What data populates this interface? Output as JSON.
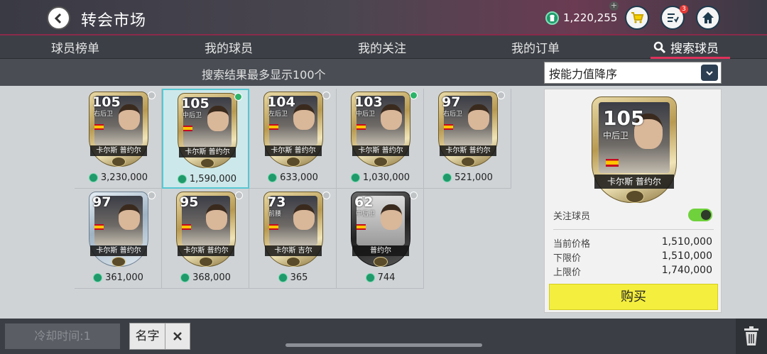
{
  "header": {
    "title": "转会市场",
    "coins": "1,220,255",
    "notification_count": "3",
    "icons": [
      "back-icon",
      "coin-icon",
      "cart-icon",
      "tasks-icon",
      "home-icon"
    ]
  },
  "tabs": [
    {
      "label": "球员榜单"
    },
    {
      "label": "我的球员"
    },
    {
      "label": "我的关注"
    },
    {
      "label": "我的订单"
    },
    {
      "label": "搜索球员",
      "active": true
    }
  ],
  "subbar": {
    "info": "搜索结果最多显示100个",
    "sort_selected": "按能力值降序"
  },
  "results": [
    {
      "rating": "105",
      "position": "右后卫",
      "name": "卡尔斯 普约尔",
      "price": "3,230,000",
      "style": "gold"
    },
    {
      "rating": "105",
      "position": "中后卫",
      "name": "卡尔斯 普约尔",
      "price": "1,590,000",
      "style": "gold",
      "selected": true,
      "favorite": true
    },
    {
      "rating": "104",
      "position": "左后卫",
      "name": "卡尔斯 普约尔",
      "price": "633,000",
      "style": "gold"
    },
    {
      "rating": "103",
      "position": "中后卫",
      "name": "卡尔斯 普约尔",
      "price": "1,030,000",
      "style": "gold",
      "favorite": true
    },
    {
      "rating": "97",
      "position": "右后卫",
      "name": "卡尔斯 普约尔",
      "price": "521,000",
      "style": "gold"
    },
    {
      "rating": "97",
      "position": "",
      "name": "卡尔斯 普约尔",
      "price": "361,000",
      "style": "silver"
    },
    {
      "rating": "95",
      "position": "",
      "name": "卡尔斯 普约尔",
      "price": "368,000",
      "style": "gold"
    },
    {
      "rating": "73",
      "position": "前腰",
      "name": "卡尔斯 吉尔",
      "price": "365",
      "style": "gold"
    },
    {
      "rating": "62",
      "position": "中后卫",
      "name": "普约尔",
      "price": "744",
      "style": "black"
    }
  ],
  "detail": {
    "rating": "105",
    "position": "中后卫",
    "name": "卡尔斯 普约尔",
    "follow_label": "关注球员",
    "follow_on": true,
    "current_price_label": "当前价格",
    "current_price": "1,510,000",
    "min_price_label": "下限价",
    "min_price": "1,510,000",
    "max_price_label": "上限价",
    "max_price": "1,740,000",
    "buy_label": "购买"
  },
  "bottom": {
    "cooldown": "冷却时间:1",
    "filter_chip": "名字"
  },
  "colors": {
    "accent": "#e0305a",
    "buy": "#f4ee3e",
    "toggle_on": "#6fd13c",
    "coin": "#1f9a6a"
  }
}
